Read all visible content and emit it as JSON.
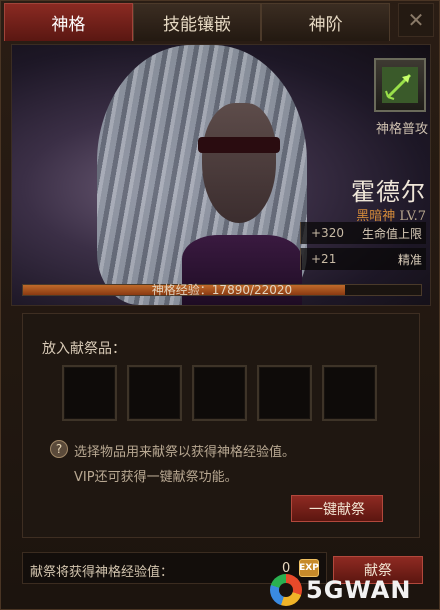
{
  "tabs": [
    {
      "label": "神格",
      "active": true
    },
    {
      "label": "技能镶嵌",
      "active": false
    },
    {
      "label": "神阶",
      "active": false
    }
  ],
  "close_label": "✕",
  "hero": {
    "skill_label": "神格普攻",
    "name": "霍德尔",
    "title": "黑暗神",
    "level": "LV.7",
    "stats": [
      {
        "value": "+320",
        "label": "生命值上限"
      },
      {
        "value": "+21",
        "label": "精准"
      }
    ],
    "xp_text": "神格经验：17890/22020",
    "xp_fraction": 0.81
  },
  "offer": {
    "label": "放入献祭品：",
    "slots": 5,
    "help_icon": "?",
    "hint_1": "选择物品用来献祭以获得神格经验值。",
    "hint_2": "VIP还可获得一键献祭功能。",
    "one_click_button": "一键献祭"
  },
  "footer": {
    "label": "献祭将获得神格经验值：",
    "value": "0",
    "exp_badge": "EXP",
    "sacrifice_button": "献祭"
  },
  "watermark": "5GWAN"
}
